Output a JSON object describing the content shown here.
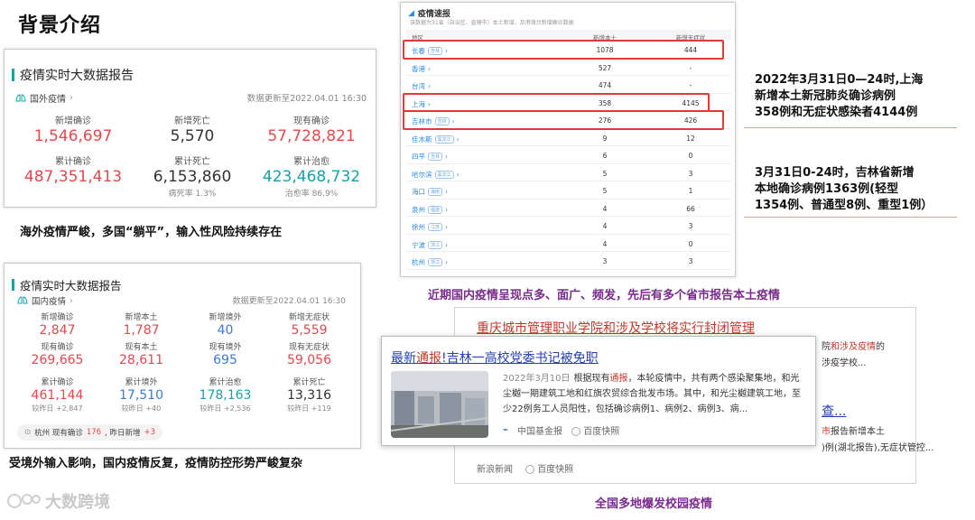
{
  "page_title": "背景介绍",
  "global_card": {
    "title": "疫情实时大数据报告",
    "scope": "国外疫情",
    "updated": "数据更新至2022.04.01 16:30",
    "stats": [
      {
        "label": "新增确诊",
        "value": "1,546,697",
        "color": "red"
      },
      {
        "label": "新增死亡",
        "value": "5,570",
        "color": "dark"
      },
      {
        "label": "现有确诊",
        "value": "57,728,821",
        "color": "red"
      },
      {
        "label": "累计确诊",
        "value": "487,351,413",
        "color": "red"
      },
      {
        "label": "累计死亡",
        "value": "6,153,860",
        "color": "dark",
        "sub": "病死率 1.3%"
      },
      {
        "label": "累计治愈",
        "value": "423,468,732",
        "color": "teal",
        "sub": "治愈率 86.9%"
      }
    ],
    "caption": "海外疫情严峻，多国“躺平”，输入性风险持续存在"
  },
  "domestic_card": {
    "title": "疫情实时大数据报告",
    "scope": "国内疫情",
    "updated": "数据更新至2022.04.01 16:30",
    "stats_top": [
      {
        "label": "新增确诊",
        "value": "2,847",
        "color": "red"
      },
      {
        "label": "新增本土",
        "value": "1,787",
        "color": "red"
      },
      {
        "label": "新增境外",
        "value": "40",
        "color": "blue"
      },
      {
        "label": "新增无症状",
        "value": "5,559",
        "color": "red"
      },
      {
        "label": "现有确诊",
        "value": "269,665",
        "color": "red"
      },
      {
        "label": "现有本土",
        "value": "28,611",
        "color": "red"
      },
      {
        "label": "现有境外",
        "value": "695",
        "color": "blue"
      },
      {
        "label": "现有无症状",
        "value": "59,056",
        "color": "red"
      }
    ],
    "stats_bottom": [
      {
        "label": "累计确诊",
        "value": "461,144",
        "color": "red",
        "sub": "较昨日 +2,847"
      },
      {
        "label": "累计境外",
        "value": "17,510",
        "color": "blue",
        "sub": "较昨日 +40"
      },
      {
        "label": "累计治愈",
        "value": "178,163",
        "color": "teal",
        "sub": "较昨日 +2,536"
      },
      {
        "label": "累计死亡",
        "value": "13,316",
        "color": "dark",
        "sub": "较昨日 +119"
      }
    ],
    "tip_prefix": "杭州 现有确诊",
    "tip_value": "176",
    "tip_mid": ", 昨日新增",
    "tip_add": "+3",
    "caption": "受境外输入影响，国内疫情反复，疫情防控形势严峻复杂"
  },
  "table": {
    "title": "疫情速报",
    "subtitle": "该数据为31省（自治区、直辖市）本土新增，及港澳台新增确诊数据",
    "headers": [
      "地区",
      "新增本土",
      "新增无症状"
    ],
    "rows": [
      {
        "city": "长春",
        "tag": "吉林",
        "local": "1078",
        "asym": "444",
        "highlight": true
      },
      {
        "city": "香港",
        "tag": "",
        "local": "527",
        "asym": "-",
        "highlight": false
      },
      {
        "city": "台湾",
        "tag": "",
        "local": "474",
        "asym": "-",
        "highlight": false
      },
      {
        "city": "上海",
        "tag": "",
        "local": "358",
        "asym": "4145",
        "highlight": true
      },
      {
        "city": "吉林市",
        "tag": "吉林",
        "local": "276",
        "asym": "426",
        "highlight": true
      },
      {
        "city": "佳木斯",
        "tag": "黑龙江",
        "local": "9",
        "asym": "12",
        "highlight": false
      },
      {
        "city": "四平",
        "tag": "吉林",
        "local": "6",
        "asym": "0",
        "highlight": false
      },
      {
        "city": "哈尔滨",
        "tag": "黑龙江",
        "local": "5",
        "asym": "3",
        "highlight": false
      },
      {
        "city": "海口",
        "tag": "海南",
        "local": "5",
        "asym": "1",
        "highlight": false
      },
      {
        "city": "泉州",
        "tag": "福建",
        "local": "4",
        "asym": "66",
        "highlight": false
      },
      {
        "city": "徐州",
        "tag": "江苏",
        "local": "4",
        "asym": "3",
        "highlight": false
      },
      {
        "city": "宁波",
        "tag": "浙江",
        "local": "4",
        "asym": "0",
        "highlight": false
      },
      {
        "city": "杭州",
        "tag": "浙江",
        "local": "3",
        "asym": "3",
        "highlight": false
      }
    ],
    "caption": "近期国内疫情呈现点多、面广、频发，先后有多个省市报告本土疫情"
  },
  "notes": {
    "shanghai": [
      "2022年3月31日0—24时,上海",
      "新增本土新冠肺炎确诊病例",
      "358例和无症状感染者4144例"
    ],
    "jilin": [
      "3月31日0-24时，吉林省新增",
      "本地确诊病例1363例(轻型",
      "1354例、普通型8例、重型1例）"
    ]
  },
  "search_back": {
    "title": "重庆城市管理职业学院和涉及学校将实行封闭管理",
    "snippet_right1_a": "院",
    "snippet_right1_b": "和涉及",
    "snippet_right1_c": "疫情",
    "snippet_right1_d": "的",
    "snippet_right2": "涉疫学校...",
    "link_right": "查...",
    "snippet_right3_a": "市",
    "snippet_right3_b": "报告新增本土",
    "snippet_right4": ")例(湖北报告),无症状管控...",
    "source": "新浪新闻",
    "snapshot": "百度快照"
  },
  "search_front": {
    "title_a": "最新",
    "title_b": "通报",
    "title_c": "!吉林一高校党委书记被免职",
    "date": "2022年3月10日",
    "text_a": "根据现有",
    "text_b": "通报",
    "text_c": "，本轮疫情中，共有两个感染聚集地，和光尘樾一期建筑工地和红旗农贸综合批发市场。其中，和光尘樾建筑工地，至少22例务工人员阳性，包括确诊病例1、病例2、病例3、病...",
    "source": "中国基金报",
    "snapshot": "百度快照"
  },
  "bottom_caption": "全国多地爆发校园疫情",
  "logo_text": "大数跨境"
}
